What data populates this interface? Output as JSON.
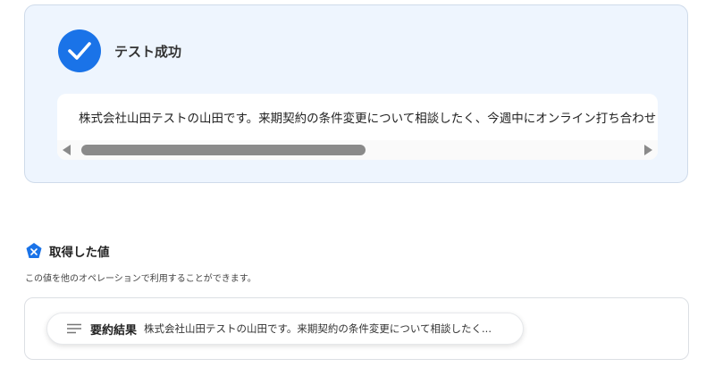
{
  "result": {
    "title": "テスト成功",
    "output_text": "株式会社山田テストの山田です。来期契約の条件変更について相談したく、今週中にオンライン打ち合わせ"
  },
  "acquired": {
    "title": "取得した値",
    "description": "この値を他のオペレーションで利用することができます。",
    "items": [
      {
        "label": "要約結果",
        "value": "株式会社山田テストの山田です。来期契約の条件変更について相談したく..."
      }
    ]
  },
  "colors": {
    "accent": "#1a73e8",
    "result_background": "#eef5fe"
  },
  "icons": [
    "check-icon",
    "scroll-left-arrow-icon",
    "scroll-right-arrow-icon",
    "x-badge-icon",
    "text-lines-icon"
  ]
}
